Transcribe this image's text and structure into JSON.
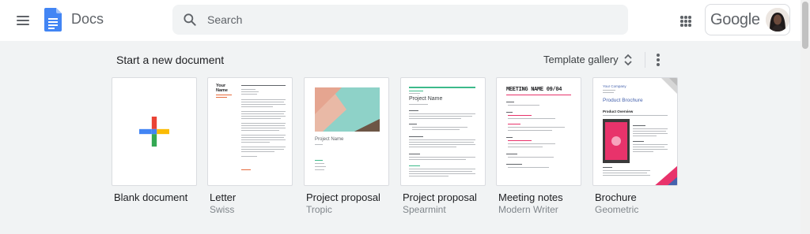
{
  "header": {
    "app_title": "Docs",
    "search_placeholder": "Search",
    "account_brand": "Google"
  },
  "gallery": {
    "section_title": "Start a new document",
    "template_gallery_label": "Template gallery",
    "templates": [
      {
        "name": "Blank document",
        "subtitle": ""
      },
      {
        "name": "Letter",
        "subtitle": "Swiss"
      },
      {
        "name": "Project proposal",
        "subtitle": "Tropic"
      },
      {
        "name": "Project proposal",
        "subtitle": "Spearmint"
      },
      {
        "name": "Meeting notes",
        "subtitle": "Modern Writer"
      },
      {
        "name": "Brochure",
        "subtitle": "Geometric"
      }
    ],
    "thumbnail_text": {
      "letter_name_1": "Your",
      "letter_name_2": "Name",
      "tropic_title": "Project Name",
      "spearmint_title": "Project Name",
      "meeting_title": "MEETING NAME 09/04",
      "brochure_company": "Your Company",
      "brochure_title": "Product Brochure",
      "brochure_section": "Product Overview"
    }
  },
  "colors": {
    "docs_blue": "#4285f4",
    "google_red": "#ea4335",
    "google_yellow": "#fbbc04",
    "google_green": "#34a853",
    "spearmint": "#3cba8a",
    "brochure_magenta": "#e8336b",
    "brochure_blue": "#4562ad"
  },
  "icons": {
    "menu": "hamburger-icon",
    "logo": "docs-logo-icon",
    "search": "search-icon",
    "apps": "apps-grid-icon",
    "sort": "unfold-more-icon",
    "more": "more-vert-icon",
    "blank": "plus-icon"
  }
}
